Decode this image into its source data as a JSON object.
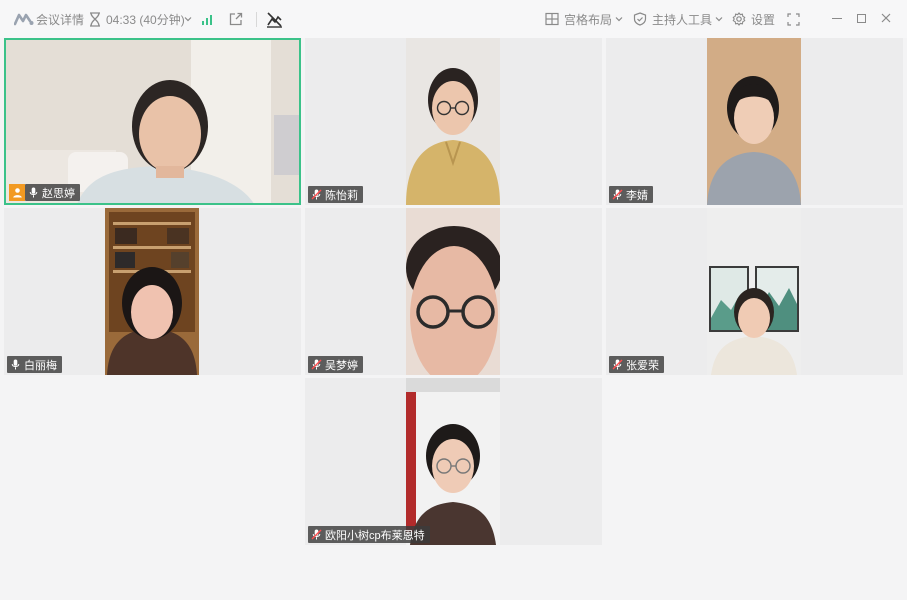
{
  "topbar": {
    "meeting_info_label": "会议详情",
    "timer_text": "04:33 (40分钟)",
    "layout_label": "宫格布局",
    "host_tools_label": "主持人工具",
    "settings_label": "设置"
  },
  "colors": {
    "active_speaker_border": "#3bc289",
    "host_badge": "#f29a22",
    "signal": "#3bc289"
  },
  "participants": [
    {
      "name": "赵思婷",
      "host": true,
      "mic": "on",
      "active": true
    },
    {
      "name": "陈怡莉",
      "host": false,
      "mic": "muted",
      "active": false
    },
    {
      "name": "李婧",
      "host": false,
      "mic": "muted",
      "active": false
    },
    {
      "name": "白丽梅",
      "host": false,
      "mic": "on",
      "active": false
    },
    {
      "name": "吴梦婷",
      "host": false,
      "mic": "muted",
      "active": false
    },
    {
      "name": "张爱荣",
      "host": false,
      "mic": "muted",
      "active": false
    },
    {
      "name": "欧阳小树cp布莱恩特",
      "host": false,
      "mic": "muted",
      "active": false
    }
  ]
}
